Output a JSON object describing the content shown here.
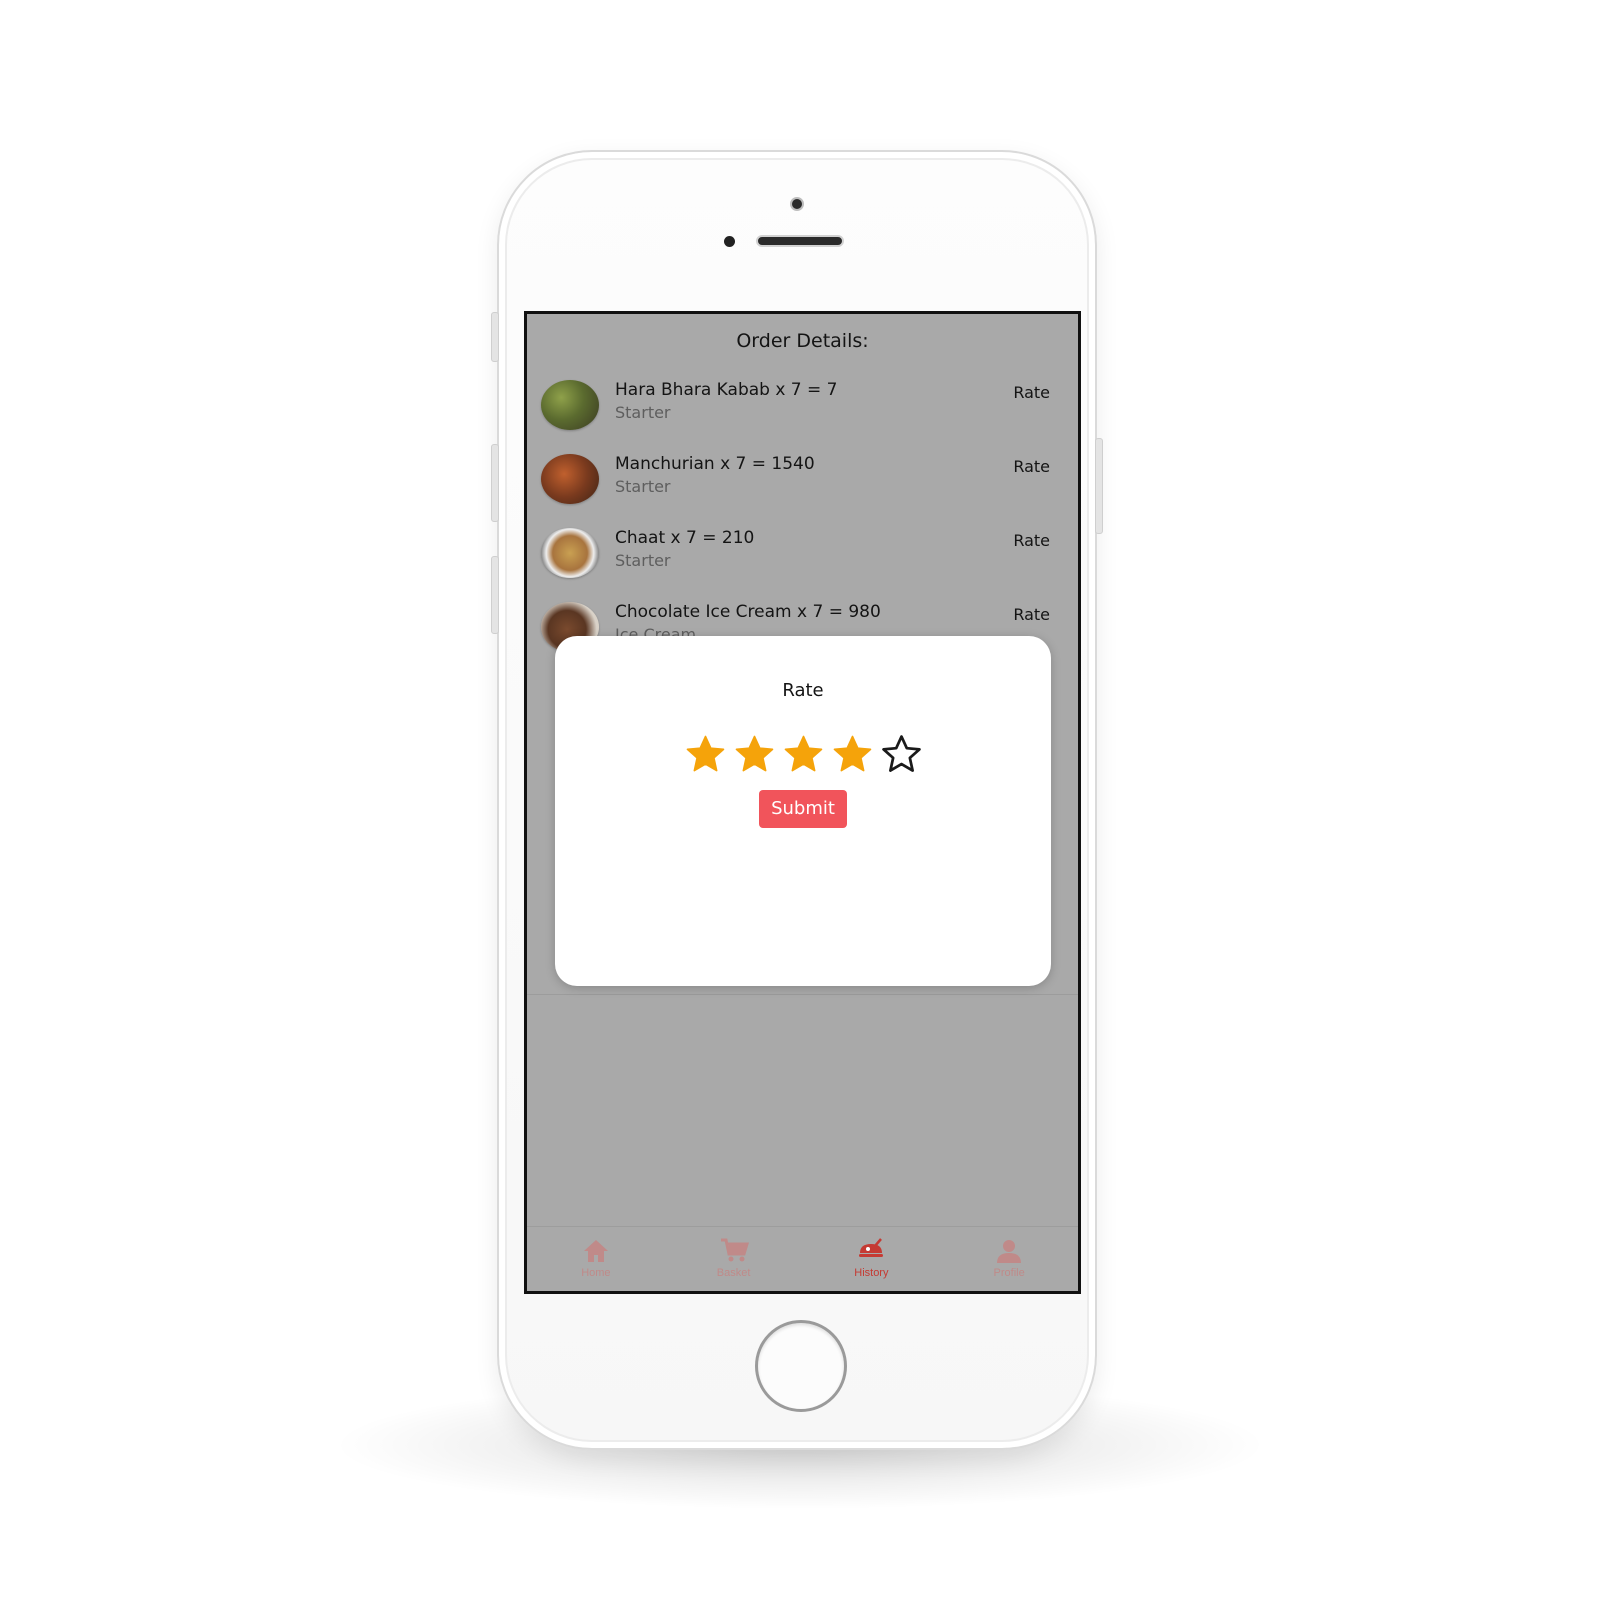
{
  "screen": {
    "title": "Order Details:"
  },
  "orders": [
    {
      "name": "Hara Bhara Kabab x 7 = 7",
      "category": "Starter",
      "rate_label": "Rate",
      "thumb_color": "#5b6b2f"
    },
    {
      "name": "Manchurian x 7 = 1540",
      "category": "Starter",
      "rate_label": "Rate",
      "thumb_color": "#7a3a1e"
    },
    {
      "name": "Chaat x 7 = 210",
      "category": "Starter",
      "rate_label": "Rate",
      "thumb_color": "#a8743e"
    },
    {
      "name": "Chocolate Ice Cream x 7 = 980",
      "category": "Ice Cream",
      "rate_label": "Rate",
      "thumb_color": "#5a3622"
    }
  ],
  "modal": {
    "title": "Rate",
    "rating": 4,
    "max_rating": 5,
    "submit_label": "Submit",
    "star_color": "#f5a30a",
    "submit_color": "#f1545b"
  },
  "tabbar": {
    "items": [
      {
        "label": "Home",
        "icon": "home-icon",
        "active": false
      },
      {
        "label": "Basket",
        "icon": "cart-icon",
        "active": false
      },
      {
        "label": "History",
        "icon": "history-icon",
        "active": true
      },
      {
        "label": "Profile",
        "icon": "profile-icon",
        "active": false
      }
    ],
    "active_color": "#c53a33",
    "inactive_color": "#c08a89"
  }
}
